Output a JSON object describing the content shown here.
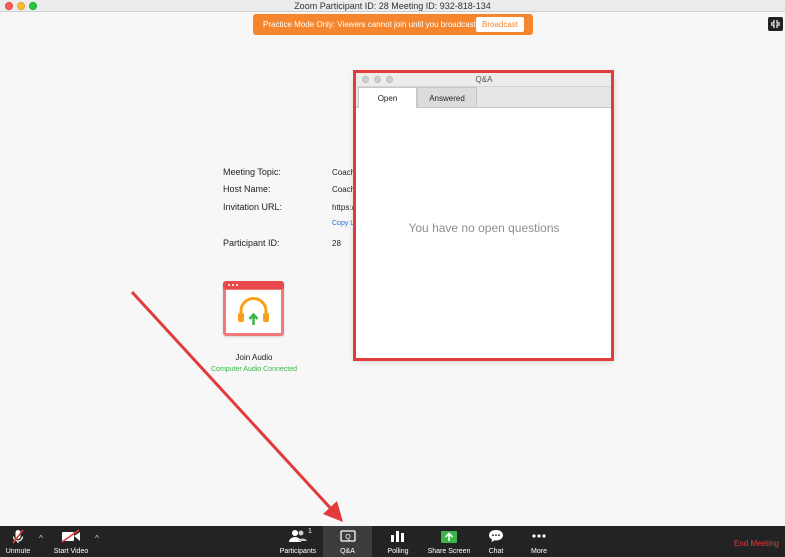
{
  "window": {
    "title": "Zoom Participant ID: 28   Meeting ID: 932-818-134"
  },
  "banner": {
    "text": "Practice Mode Only: Viewers cannot join until you broadcast",
    "button": "Broadcast",
    "color": "#f5862d"
  },
  "meeting_info": {
    "topic_label": "Meeting Topic:",
    "topic_value": "Coach",
    "host_label": "Host Name:",
    "host_value": "Coach",
    "url_label": "Invitation URL:",
    "url_value": "https://",
    "copy_link": "Copy L",
    "participant_label": "Participant ID:",
    "participant_value": "28"
  },
  "audio": {
    "label": "Join Audio",
    "status": "Computer Audio Connected",
    "status_color": "#3bb54a",
    "icon": "headphones-icon"
  },
  "qa": {
    "title": "Q&A",
    "tabs": [
      "Open",
      "Answered"
    ],
    "active_tab": "Open",
    "empty_message": "You have no open questions"
  },
  "toolbar": {
    "unmute": "Unmute",
    "start_video": "Start Video",
    "participants": "Participants",
    "participants_count": "1",
    "qa": "Q&A",
    "polling": "Polling",
    "share_screen": "Share Screen",
    "chat": "Chat",
    "more": "More",
    "end_meeting": "End Meeting",
    "end_color": "#e33a3a"
  },
  "annotation": {
    "highlight_color": "#e13b3b"
  }
}
